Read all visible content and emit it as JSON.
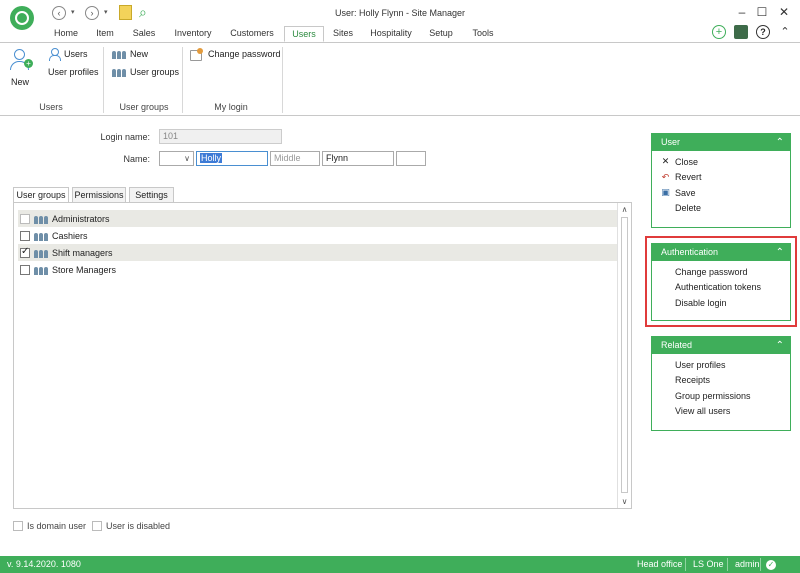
{
  "window": {
    "title": "User: Holly Flynn - Site Manager",
    "minimize_icon": "minimize-icon",
    "maximize_icon": "maximize-icon",
    "close_icon": "close-icon"
  },
  "tabs": [
    {
      "label": "Home"
    },
    {
      "label": "Item"
    },
    {
      "label": "Sales"
    },
    {
      "label": "Inventory"
    },
    {
      "label": "Customers"
    },
    {
      "label": "Users",
      "active": true
    },
    {
      "label": "Sites"
    },
    {
      "label": "Hospitality"
    },
    {
      "label": "Setup"
    },
    {
      "label": "Tools"
    }
  ],
  "ribbon": {
    "users_group": {
      "new_label": "New",
      "users_label": "Users",
      "user_profiles_label": "User profiles",
      "group_label": "Users"
    },
    "user_groups_group": {
      "new_label": "New",
      "user_groups_label": "User groups",
      "group_label": "User groups"
    },
    "my_login_group": {
      "change_password_label": "Change password",
      "group_label": "My login"
    }
  },
  "form": {
    "login_name_label": "Login name:",
    "login_name_value": "101",
    "name_label": "Name:",
    "prefix_value": "",
    "first_name_value": "Holly",
    "middle_placeholder": "Middle",
    "last_name_value": "Flynn",
    "suffix_value": ""
  },
  "content_tabs": [
    {
      "label": "User groups",
      "active": true
    },
    {
      "label": "Permissions"
    },
    {
      "label": "Settings"
    }
  ],
  "user_groups": [
    {
      "label": "Administrators",
      "checked": false,
      "disabled": true,
      "shaded": true
    },
    {
      "label": "Cashiers",
      "checked": false,
      "disabled": false,
      "shaded": false
    },
    {
      "label": "Shift managers",
      "checked": true,
      "disabled": false,
      "shaded": true
    },
    {
      "label": "Store Managers",
      "checked": false,
      "disabled": false,
      "shaded": false
    }
  ],
  "options": {
    "is_domain_user_label": "Is domain user",
    "user_is_disabled_label": "User is disabled"
  },
  "panels": {
    "user": {
      "title": "User",
      "items": [
        "Close",
        "Revert",
        "Save",
        "Delete"
      ]
    },
    "authentication": {
      "title": "Authentication",
      "items": [
        "Change password",
        "Authentication tokens",
        "Disable login"
      ]
    },
    "related": {
      "title": "Related",
      "items": [
        "User profiles",
        "Receipts",
        "Group permissions",
        "View all users"
      ]
    }
  },
  "status": {
    "version": "v. 9.14.2020. 1080",
    "store": "Head office",
    "product": "LS One",
    "user": "admin"
  },
  "colors": {
    "accent": "#3fae5a",
    "highlight_outline": "#e03b3b",
    "selection": "#3d7bd6"
  }
}
